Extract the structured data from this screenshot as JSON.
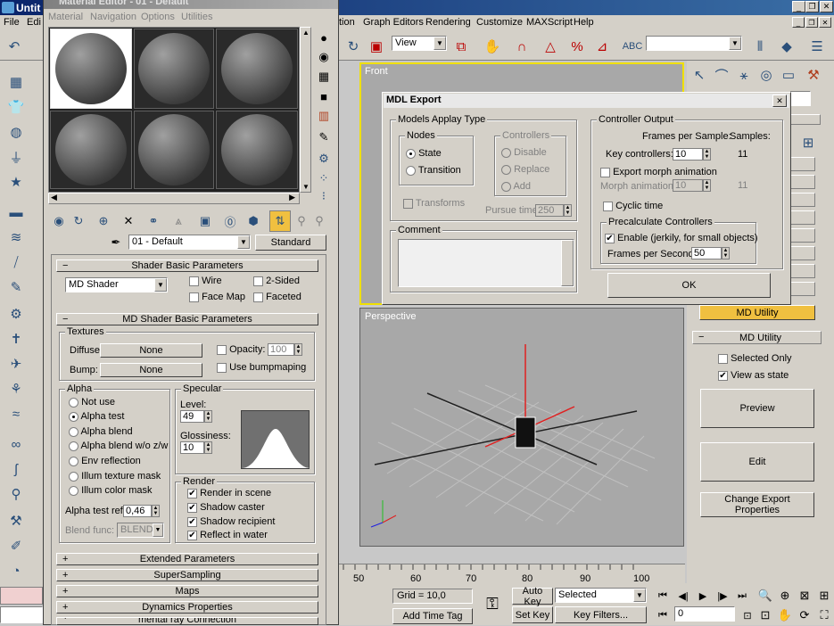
{
  "main": {
    "title": "Untit",
    "menu": [
      "File",
      "Edi",
      "tion",
      "Graph Editors",
      "Rendering",
      "Customize",
      "MAXScript",
      "Help"
    ],
    "view_dropdown": "View",
    "selection_dropdown": "Selected",
    "key_filters": "Key Filters...",
    "auto_key": "Auto Key",
    "set_key": "Set Key",
    "grid": "Grid = 10,0",
    "add_time_tag": "Add Time Tag",
    "frame_field": "0",
    "timeline_ticks": [
      "50",
      "60",
      "70",
      "80",
      "90",
      "100"
    ],
    "viewport_front": "Front",
    "viewport_perspective": "Perspective"
  },
  "right_panel": {
    "md_utility_button": "MD Utility",
    "rollout_title": "MD Utility",
    "selected_only": "Selected Only",
    "view_as_state": "View as state",
    "preview": "Preview",
    "edit": "Edit",
    "change_export": "Change Export Properties"
  },
  "material_editor": {
    "title": "Material Editor - 01 - Default",
    "menu": [
      "Material",
      "Navigation",
      "Options",
      "Utilities"
    ],
    "material_name": "01 - Default",
    "material_type": "Standard",
    "shader_rollout": "Shader Basic Parameters",
    "shader": "MD Shader",
    "wire": "Wire",
    "two_sided": "2-Sided",
    "face_map": "Face Map",
    "faceted": "Faceted",
    "md_rollout": "MD Shader Basic Parameters",
    "textures_label": "Textures",
    "diffuse_label": "Diffuse:",
    "diffuse_value": "None",
    "bump_label": "Bump:",
    "bump_value": "None",
    "opacity_label": "Opacity:",
    "opacity_value": "100",
    "use_bump": "Use bumpmaping",
    "alpha_label": "Alpha",
    "alpha_options": [
      "Not use",
      "Alpha test",
      "Alpha blend",
      "Alpha blend w/o z/w",
      "Env reflection",
      "Illum texture mask",
      "Illum color mask"
    ],
    "alpha_test_ref_label": "Alpha test ref:",
    "alpha_test_ref": "0,46",
    "blend_func_label": "Blend func:",
    "blend_func": "BLEND",
    "specular_label": "Specular",
    "level_label": "Level:",
    "level": "49",
    "glossiness_label": "Glossiness:",
    "glossiness": "10",
    "render_label": "Render",
    "render_options": [
      "Render in scene",
      "Shadow caster",
      "Shadow recipient",
      "Reflect in water"
    ],
    "rollouts": [
      "Extended Parameters",
      "SuperSampling",
      "Maps",
      "Dynamics Properties",
      "mental ray Connection"
    ]
  },
  "dialog": {
    "title": "MDL Export",
    "models_group": "Models Applay Type",
    "nodes_group": "Nodes",
    "state": "State",
    "transition": "Transition",
    "controllers_group": "Controllers",
    "disable": "Disable",
    "replace": "Replace",
    "add": "Add",
    "transforms": "Transforms",
    "pursue_time_label": "Pursue time:",
    "pursue_time": "250",
    "comment_group": "Comment",
    "controller_output_group": "Controller Output",
    "frames_per_sample": "Frames per Sample:",
    "samples": "Samples:",
    "key_controllers_label": "Key controllers:",
    "key_controllers": "10",
    "key_samples": "11",
    "export_morph": "Export morph animation",
    "morph_animation_label": "Morph animation:",
    "morph_value": "10",
    "morph_samples": "11",
    "cyclic_time": "Cyclic time",
    "precalc_group": "Precalculate Controllers",
    "enable": "Enable (jerkily, for small objects)",
    "fps_label": "Frames per Second:",
    "fps": "50",
    "ok": "OK"
  }
}
